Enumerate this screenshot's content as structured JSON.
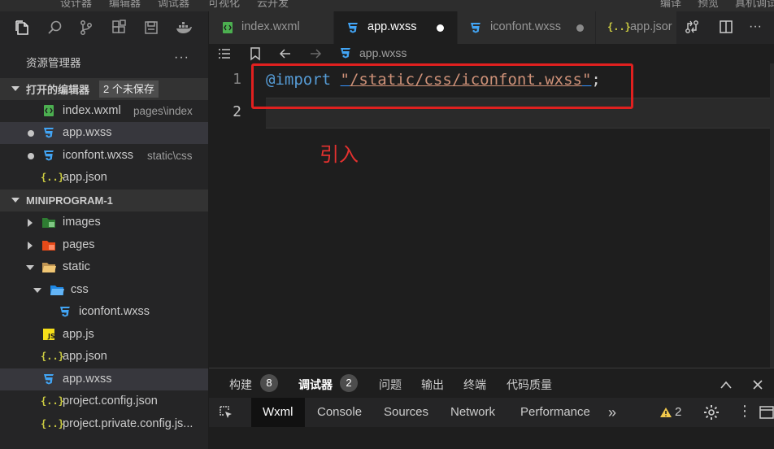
{
  "menubar": [
    "设计器",
    "编辑器",
    "调试器",
    "可视化",
    "云开发",
    "编译",
    "预览",
    "真机调试"
  ],
  "sidebar": {
    "title": "资源管理器",
    "more": "···",
    "open_editors": {
      "label": "打开的编辑器",
      "badge": "2 个未保存",
      "items": [
        {
          "name": "index.wxml",
          "desc": "pages\\index",
          "icon": "wxml-icon"
        },
        {
          "name": "app.wxss",
          "desc": "",
          "icon": "css-icon"
        },
        {
          "name": "iconfont.wxss",
          "desc": "static\\css",
          "icon": "css-icon"
        },
        {
          "name": "app.json",
          "desc": "",
          "icon": "json-icon"
        }
      ]
    },
    "project": {
      "label": "MINIPROGRAM-1",
      "items": [
        {
          "name": "images"
        },
        {
          "name": "pages"
        },
        {
          "name": "static"
        },
        {
          "name": "css"
        },
        {
          "name": "iconfont.wxss"
        },
        {
          "name": "app.js"
        },
        {
          "name": "app.json"
        },
        {
          "name": "app.wxss"
        },
        {
          "name": "project.config.json"
        },
        {
          "name": "project.private.config.js..."
        }
      ]
    }
  },
  "tabs": [
    {
      "label": "index.wxml",
      "icon": "wxml-icon"
    },
    {
      "label": "app.wxss",
      "icon": "css-icon",
      "active": true
    },
    {
      "label": "iconfont.wxss",
      "icon": "css-icon"
    },
    {
      "label": "app.jsor",
      "icon": "json-icon"
    }
  ],
  "breadcrumb": {
    "file": "app.wxss"
  },
  "editor": {
    "line_numbers": [
      "1",
      "2"
    ],
    "code": {
      "keyword": "@import",
      "string_open": "\"",
      "path": "/static/css/iconfont.wxss",
      "string_close": "\"",
      "semicolon": ";"
    },
    "annotation": "引入"
  },
  "panel": {
    "tabs": [
      {
        "label": "构建",
        "badge": "8"
      },
      {
        "label": "调试器",
        "badge": "2",
        "active": true
      },
      {
        "label": "问题"
      },
      {
        "label": "输出"
      },
      {
        "label": "终端"
      },
      {
        "label": "代码质量"
      }
    ],
    "devtools": {
      "tabs": [
        "Wxml",
        "Console",
        "Sources",
        "Network",
        "Performance"
      ],
      "more": "»",
      "warnings": "2"
    }
  },
  "colors": {
    "accent_red": "#e0201f",
    "keyword": "#569cd6",
    "string": "#ce9178",
    "css_icon": "#42a5f5",
    "json_icon": "#cbcb41"
  }
}
